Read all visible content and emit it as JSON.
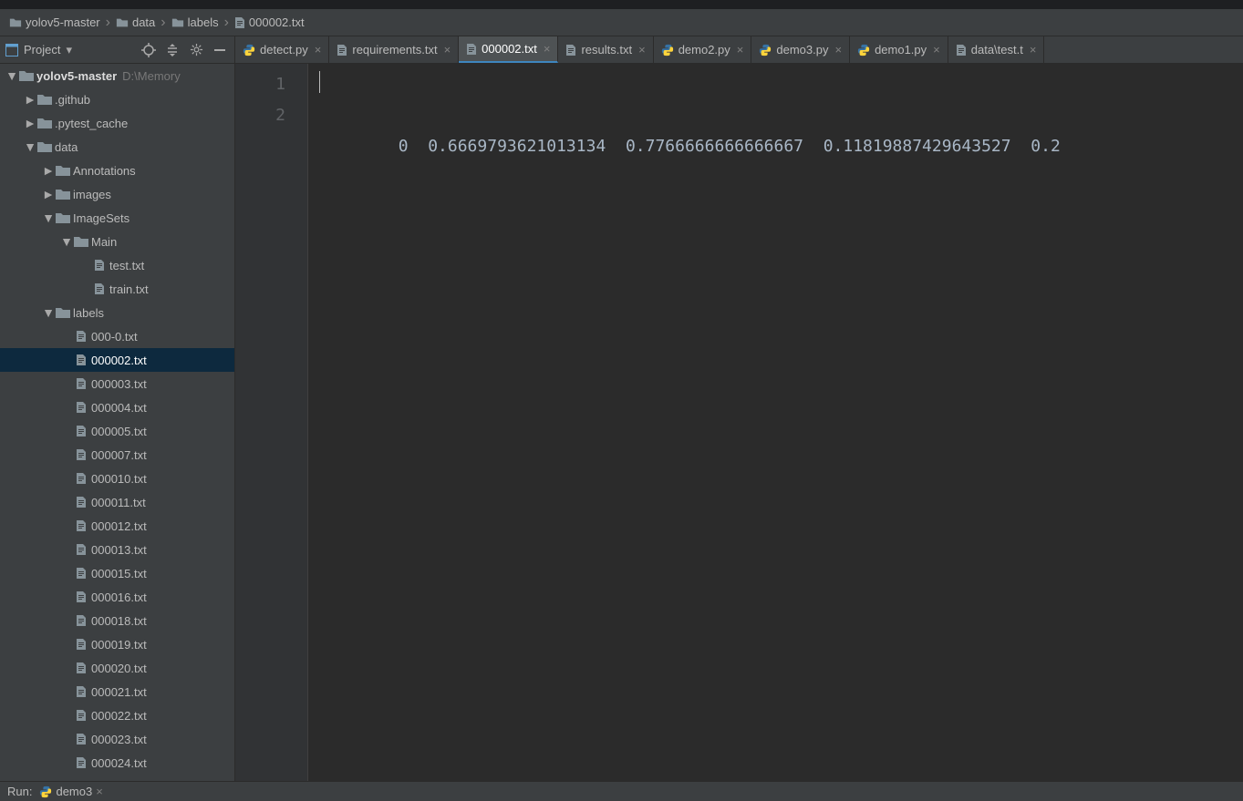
{
  "breadcrumb": {
    "root": "yolov5-master",
    "part1": "data",
    "part2": "labels",
    "part3": "000002.txt"
  },
  "toolbar": {
    "project_label": "Project"
  },
  "tree": {
    "root_label": "yolov5-master",
    "root_hint": "D:\\Memory",
    "items": [
      {
        "name": ".github",
        "type": "folder",
        "indent": 1,
        "arrow": "►"
      },
      {
        "name": ".pytest_cache",
        "type": "folder",
        "indent": 1,
        "arrow": "►"
      },
      {
        "name": "data",
        "type": "folder",
        "indent": 1,
        "arrow": "▼"
      },
      {
        "name": "Annotations",
        "type": "folder",
        "indent": 2,
        "arrow": "►"
      },
      {
        "name": "images",
        "type": "folder",
        "indent": 2,
        "arrow": "►"
      },
      {
        "name": "ImageSets",
        "type": "folder",
        "indent": 2,
        "arrow": "▼"
      },
      {
        "name": "Main",
        "type": "folder",
        "indent": 3,
        "arrow": "▼"
      },
      {
        "name": "test.txt",
        "type": "file",
        "indent": 4
      },
      {
        "name": "train.txt",
        "type": "file",
        "indent": 4
      },
      {
        "name": "labels",
        "type": "folder",
        "indent": 2,
        "arrow": "▼"
      },
      {
        "name": "000-0.txt",
        "type": "file",
        "indent": 3
      },
      {
        "name": "000002.txt",
        "type": "file",
        "indent": 3,
        "selected": true
      },
      {
        "name": "000003.txt",
        "type": "file",
        "indent": 3
      },
      {
        "name": "000004.txt",
        "type": "file",
        "indent": 3
      },
      {
        "name": "000005.txt",
        "type": "file",
        "indent": 3
      },
      {
        "name": "000007.txt",
        "type": "file",
        "indent": 3
      },
      {
        "name": "000010.txt",
        "type": "file",
        "indent": 3
      },
      {
        "name": "000011.txt",
        "type": "file",
        "indent": 3
      },
      {
        "name": "000012.txt",
        "type": "file",
        "indent": 3
      },
      {
        "name": "000013.txt",
        "type": "file",
        "indent": 3
      },
      {
        "name": "000015.txt",
        "type": "file",
        "indent": 3
      },
      {
        "name": "000016.txt",
        "type": "file",
        "indent": 3
      },
      {
        "name": "000018.txt",
        "type": "file",
        "indent": 3
      },
      {
        "name": "000019.txt",
        "type": "file",
        "indent": 3
      },
      {
        "name": "000020.txt",
        "type": "file",
        "indent": 3
      },
      {
        "name": "000021.txt",
        "type": "file",
        "indent": 3
      },
      {
        "name": "000022.txt",
        "type": "file",
        "indent": 3
      },
      {
        "name": "000023.txt",
        "type": "file",
        "indent": 3
      },
      {
        "name": "000024.txt",
        "type": "file",
        "indent": 3
      }
    ]
  },
  "tabs": [
    {
      "label": "detect.py",
      "type": "py"
    },
    {
      "label": "requirements.txt",
      "type": "txt"
    },
    {
      "label": "000002.txt",
      "type": "txt",
      "active": true
    },
    {
      "label": "results.txt",
      "type": "txt"
    },
    {
      "label": "demo2.py",
      "type": "py"
    },
    {
      "label": "demo3.py",
      "type": "py"
    },
    {
      "label": "demo1.py",
      "type": "py"
    },
    {
      "label": "data\\test.t",
      "type": "txt"
    }
  ],
  "editor": {
    "lines": [
      "1",
      "2"
    ],
    "content": "0  0.6669793621013134  0.7766666666666667  0.11819887429643527  0.2"
  },
  "bottombar": {
    "run_label": "Run:",
    "run_target": "demo3"
  }
}
